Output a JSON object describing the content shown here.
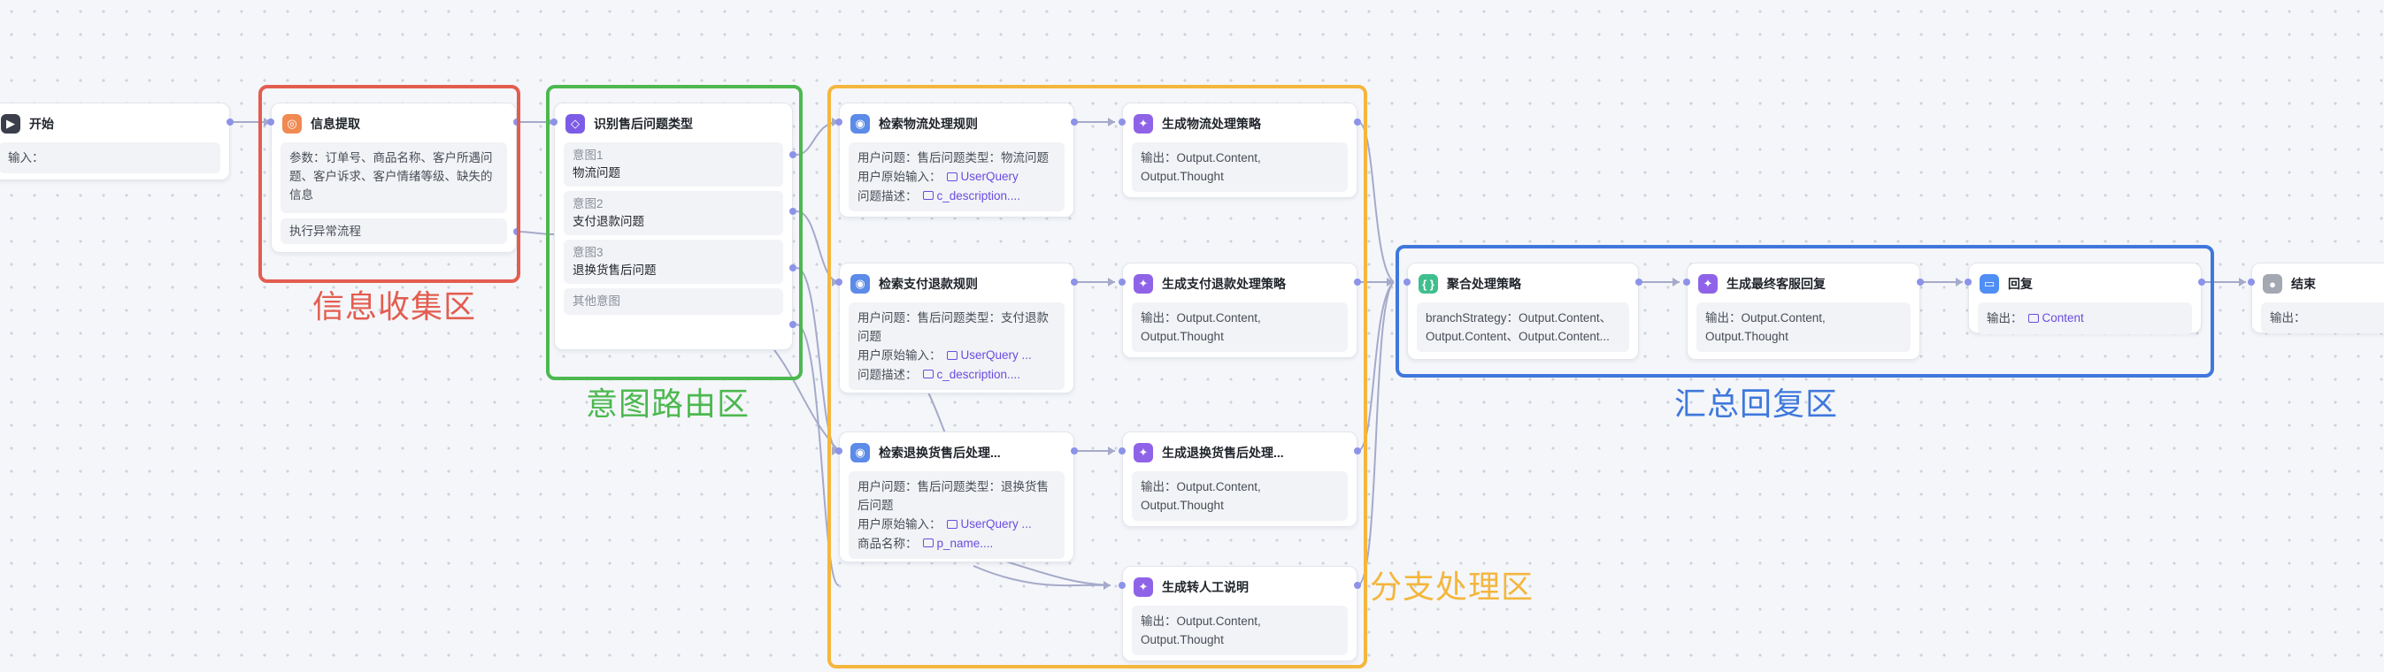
{
  "colors": {
    "red": "#e35d4f",
    "green": "#4cb84f",
    "yellow": "#f4b63c",
    "blue": "#3f78dc",
    "accent": "#7c5ce6",
    "edge": "#a5aac9"
  },
  "regions": {
    "collect": "信息收集区",
    "route": "意图路由区",
    "branch": "分支处理区",
    "summary": "汇总回复区"
  },
  "start": {
    "title": "开始",
    "input_label": "输入：",
    "icon": "start-icon"
  },
  "extract": {
    "title": "信息提取",
    "params": "参数：订单号、商品名称、客户所遇问题、客户诉求、客户情绪等级、缺失的信息",
    "exception": "执行异常流程",
    "icon": "extract-icon"
  },
  "classify": {
    "title": "识别售后问题类型",
    "icon": "intent-icon",
    "intents": [
      {
        "k": "意图1",
        "v": "物流问题"
      },
      {
        "k": "意图2",
        "v": "支付退款问题"
      },
      {
        "k": "意图3",
        "v": "退换货售后问题"
      }
    ],
    "other": "其他意图"
  },
  "kb1": {
    "title": "检索物流处理规则",
    "l1": "用户问题：售后问题类型：物流问题",
    "l2_label": "用户原始输入：",
    "l2_tag": "UserQuery",
    "l3_label": "问题描述：",
    "l3_tag": "c_description...."
  },
  "kb2": {
    "title": "检索支付退款规则",
    "l1": "用户问题：售后问题类型：支付退款问题",
    "l2_label": "用户原始输入：",
    "l2_tag": "UserQuery ...",
    "l3_label": "问题描述：",
    "l3_tag": "c_description...."
  },
  "kb3": {
    "title": "检索退换货售后处理...",
    "l1": "用户问题：售后问题类型：退换货售后问题",
    "l2_label": "用户原始输入：",
    "l2_tag": "UserQuery ...",
    "l3_label": "商品名称：",
    "l3_tag": "p_name...."
  },
  "gen1": {
    "title": "生成物流处理策略",
    "out": "输出：Output.Content, Output.Thought"
  },
  "gen2": {
    "title": "生成支付退款处理策略",
    "out": "输出：Output.Content, Output.Thought"
  },
  "gen3": {
    "title": "生成退换货售后处理...",
    "out": "输出：Output.Content, Output.Thought"
  },
  "gen4": {
    "title": "生成转人工说明",
    "out": "输出：Output.Content, Output.Thought"
  },
  "agg": {
    "title": "聚合处理策略",
    "body": "branchStrategy：Output.Content、Output.Content、Output.Content..."
  },
  "final": {
    "title": "生成最终客服回复",
    "out": "输出：Output.Content, Output.Thought"
  },
  "reply": {
    "title": "回复",
    "out_label": "输出：",
    "out_tag": "Content"
  },
  "end": {
    "title": "结束",
    "out_label": "输出："
  }
}
